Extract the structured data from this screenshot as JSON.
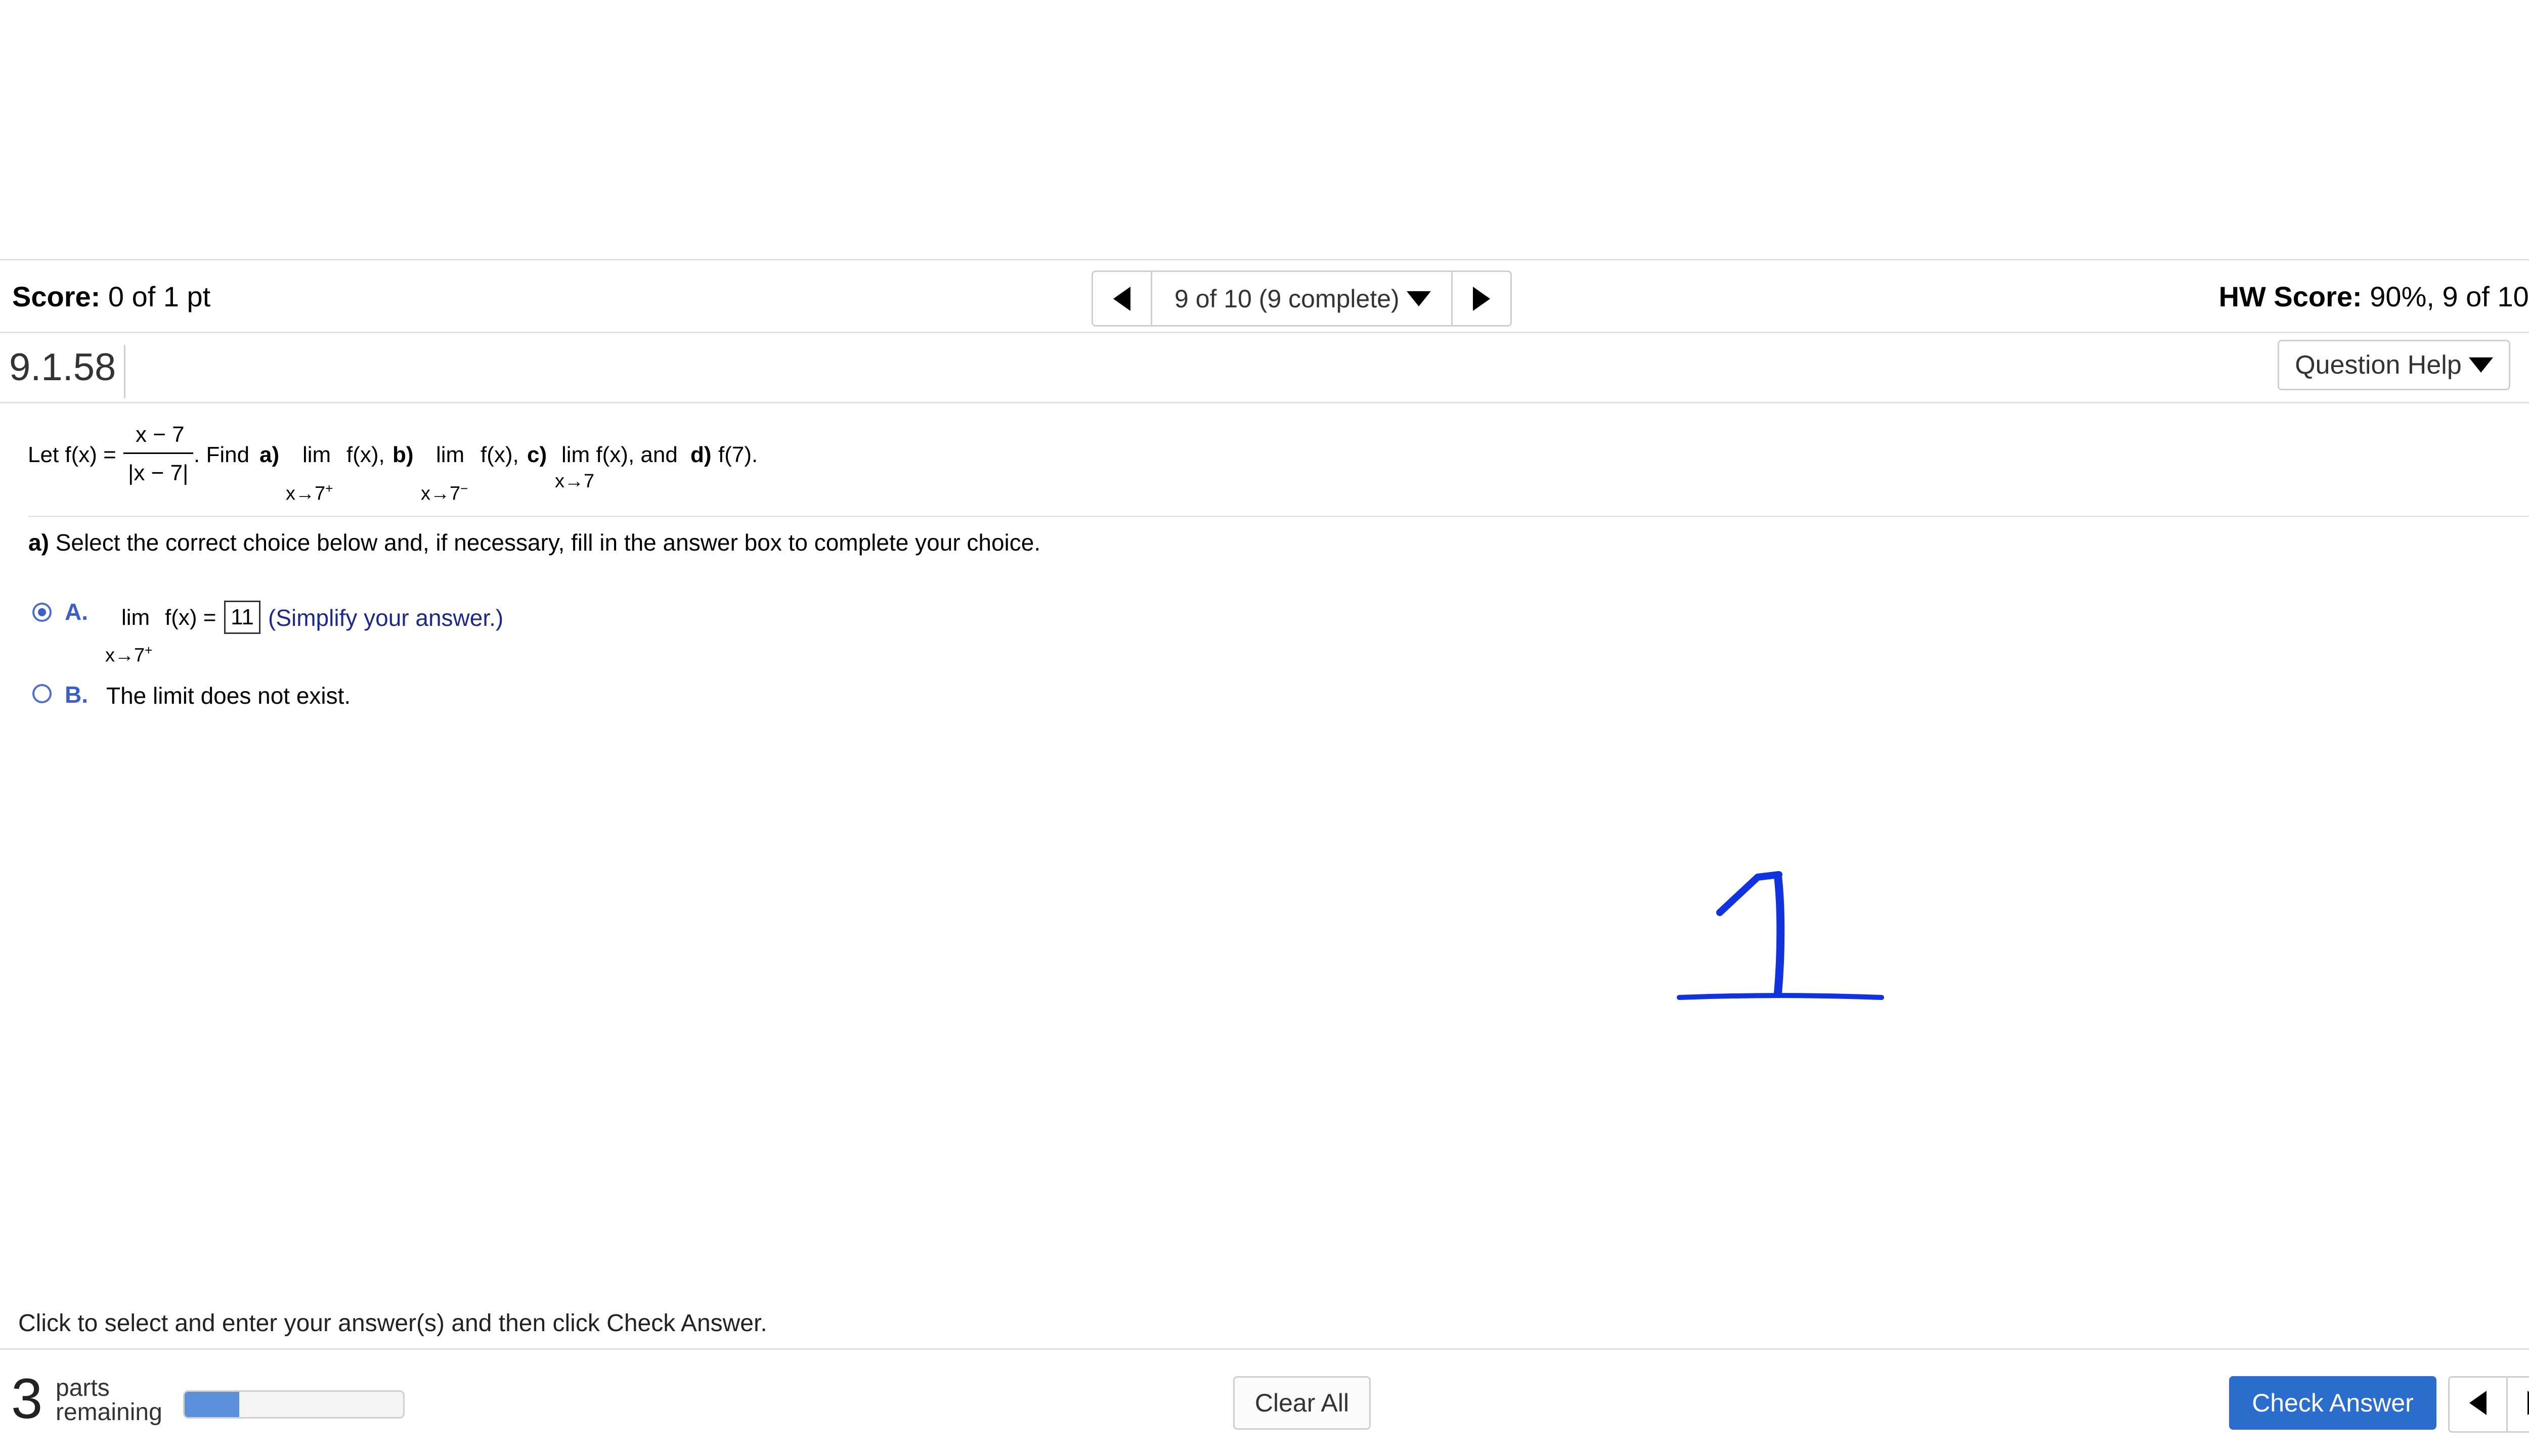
{
  "score_bar": {
    "score_label": "Score:",
    "score_value": "0 of 1 pt",
    "nav_position": "9 of 10 (9 complete)",
    "hw_score_label": "HW Score:",
    "hw_score_value": "90%, 9 of 10 pts"
  },
  "question": {
    "number": "9.1.58",
    "help_label": "Question Help",
    "problem": {
      "let": "Let f(x) =",
      "numerator": "x − 7",
      "denominator": "|x − 7|",
      "find": ". Find",
      "a_label": "a)",
      "lim": "lim",
      "fx_comma": "f(x),",
      "b_label": "b)",
      "c_label": "c)",
      "c_expr": "lim f(x), and",
      "d_label": "d)",
      "d_expr": "f(7).",
      "sub_a": "x→7",
      "sup_a": "+",
      "sub_b": "x→7",
      "sup_b": "−",
      "sub_c": "x→7"
    },
    "part_a": {
      "label": "a)",
      "instruction": "Select the correct choice below and, if necessary, fill in the answer box to complete your choice."
    },
    "choices": [
      {
        "letter": "A.",
        "lim": "lim",
        "fx_eq": "f(x) =",
        "sub": "x→7",
        "sup": "+",
        "answer": "11",
        "hint": "(Simplify your answer.)",
        "selected": true
      },
      {
        "letter": "B.",
        "text": "The limit does not exist.",
        "selected": false
      }
    ]
  },
  "footer": {
    "instruction": "Click to select and enter your answer(s) and then click Check Answer.",
    "help_symbol": "?",
    "parts_count": "3",
    "parts_word1": "parts",
    "parts_word2": "remaining",
    "progress_fraction": 0.25,
    "clear_all": "Clear All",
    "check_answer": "Check Answer"
  },
  "colors": {
    "accent": "#2b6dcc",
    "handwriting": "#1133dd",
    "help_circle": "#f4d03f"
  }
}
